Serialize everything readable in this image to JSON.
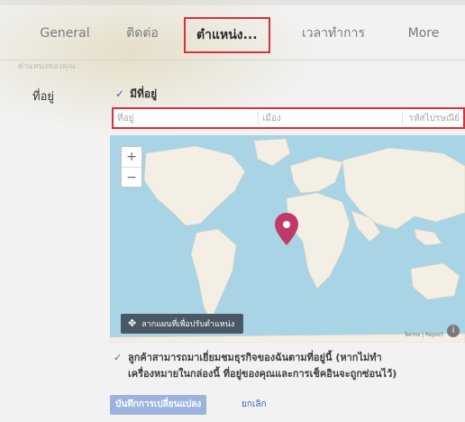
{
  "tabs": [
    {
      "label": "General"
    },
    {
      "label": "ติดต่อ"
    },
    {
      "label": "ตำแหน่ง..."
    },
    {
      "label": "เวลาทำการ"
    },
    {
      "label": "More"
    }
  ],
  "active_tab": "ตำแหน่ง...",
  "section_hint": "ตำแหน่งของคุณ",
  "location": {
    "label": "ที่อยู่",
    "has_address_label": "มีที่อยู่",
    "has_address_checked": true,
    "address_placeholder": "ที่อยู่",
    "city_placeholder": "เมือง",
    "zip_placeholder": "รหัสไปรษณีย์"
  },
  "map": {
    "zoom_in": "+",
    "zoom_out": "−",
    "adjust_button": "ลากแผนที่เพื่อปรับตำแหน่ง",
    "adjust_icon": "move-icon",
    "info_icon": "info-icon",
    "info_glyph": "i",
    "attribution": "Terms | Report",
    "marker_color": "#c0396b",
    "water_color": "#a9d4e6",
    "land_color": "#f3efe5"
  },
  "agree": {
    "checked": true,
    "line1": "ลูกค้าสามารถมาเยี่ยมชมธุรกิจของฉันตามที่อยู่นี้ (หากไม่ทำ",
    "line2": "เครื่องหมายในกล่องนี้ ที่อยู่ของคุณและการเช็คอินจะถูกซ่อนไว้)"
  },
  "actions": {
    "save": "บันทึกการเปลี่ยนแปลง",
    "cancel": "ยกเลิก"
  },
  "colors": {
    "highlight": "#d9303a",
    "primary_disabled": "#9db3de",
    "link": "#4267b2"
  }
}
